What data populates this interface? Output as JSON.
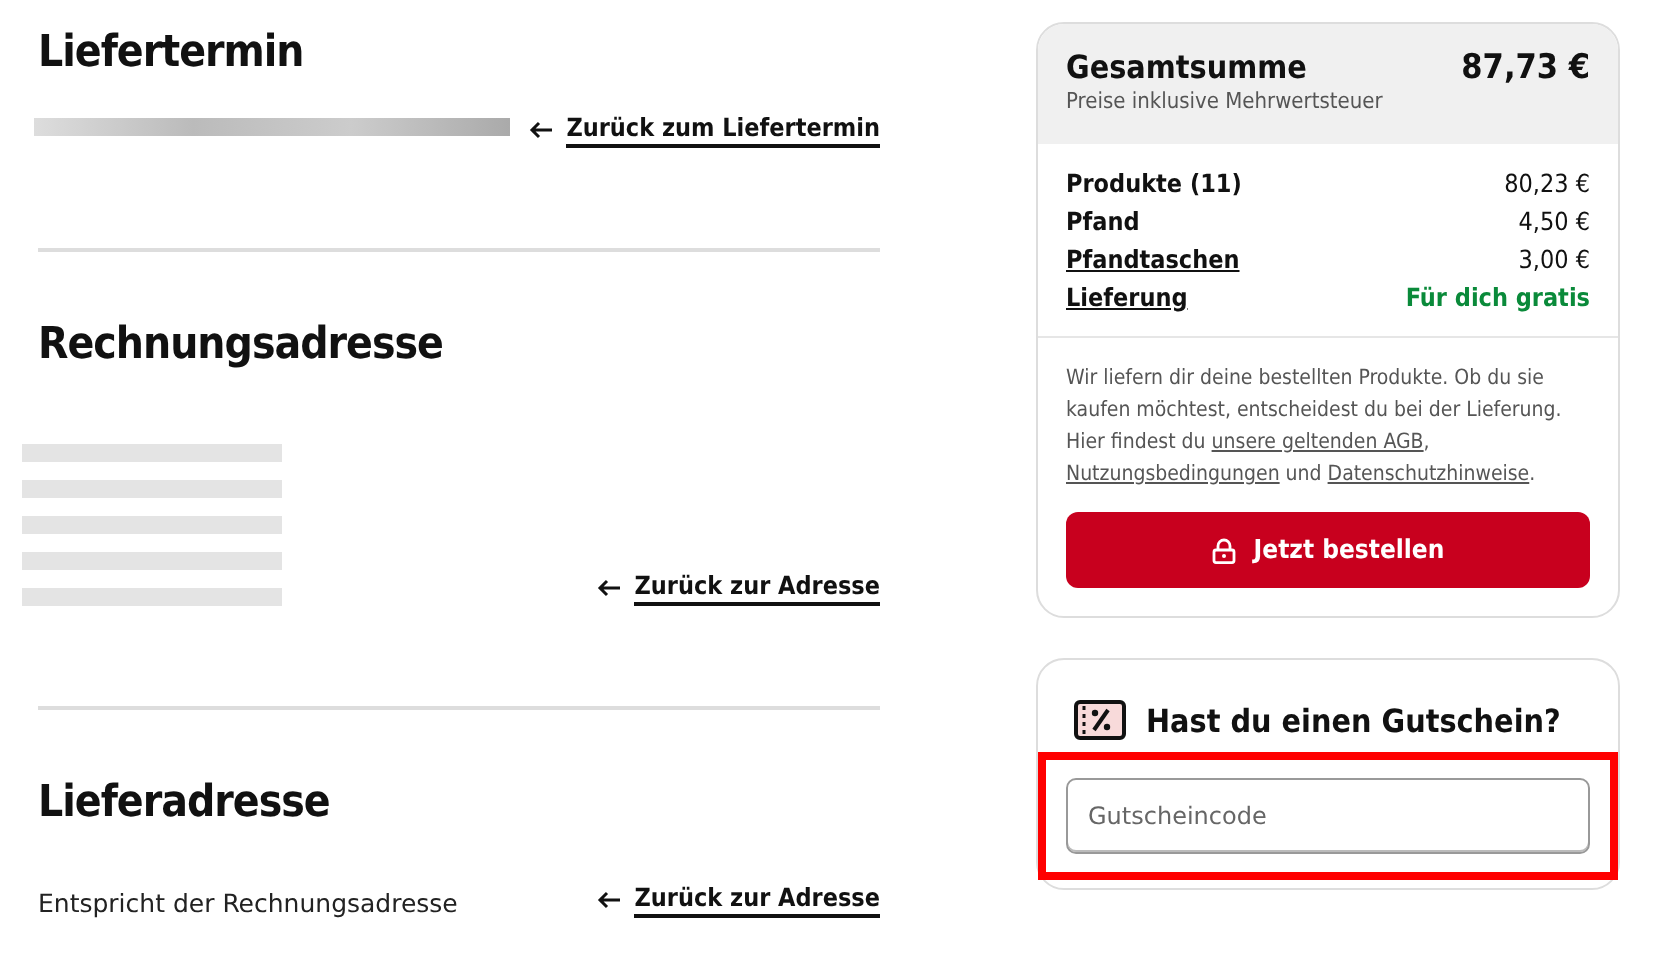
{
  "sections": [
    {
      "kind": "date",
      "heading": "Liefertermin",
      "back_link": "Zurück zum Liefertermin"
    },
    {
      "kind": "address",
      "heading": "Rechnungsadresse",
      "back_link": "Zurück zur Adresse"
    },
    {
      "kind": "note",
      "heading": "Lieferadresse",
      "text": "Entspricht der Rechnungsadresse",
      "back_link": "Zurück zur Adresse"
    }
  ],
  "summary": {
    "title": "Gesamtsumme",
    "total": "87,73 €",
    "subtitle": "Preise inklusive Mehrwertsteuer",
    "lines": [
      {
        "label": "Produkte (11)",
        "value": "80,23 €",
        "link": false,
        "highlight": false
      },
      {
        "label": "Pfand",
        "value": "4,50 €",
        "link": false,
        "highlight": false
      },
      {
        "label": "Pfandtaschen",
        "value": "3,00 €",
        "link": true,
        "highlight": false
      },
      {
        "label": "Lieferung",
        "value": "Für dich gratis",
        "link": true,
        "highlight": true
      }
    ],
    "notice": [
      {
        "text": "Wir liefern dir deine bestellten Produkte. Ob du sie kaufen möchtest, entscheidest du bei der Lieferung. Hier findest du ",
        "link": false
      },
      {
        "text": "unsere geltenden AGB",
        "link": true
      },
      {
        "text": ", ",
        "link": false
      },
      {
        "text": "Nutzungsbedingungen",
        "link": true
      },
      {
        "text": " und ",
        "link": false
      },
      {
        "text": "Datenschutzhinweise",
        "link": true
      },
      {
        "text": ".",
        "link": false
      }
    ],
    "order_button": "Jetzt bestellen"
  },
  "voucher": {
    "title": "Hast du einen Gutschein?",
    "placeholder": "Gutscheincode",
    "highlighted": true
  }
}
